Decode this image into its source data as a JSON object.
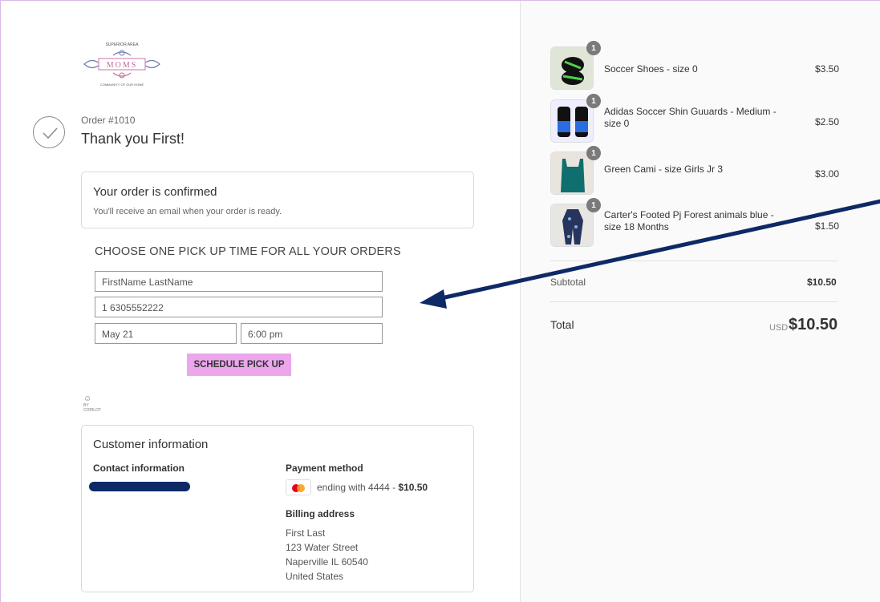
{
  "logo": {
    "text": "MOMS",
    "arc_top": "SUPERIOR AREA",
    "arc_bottom": "COMMUNITY OF OUR HOME"
  },
  "order": {
    "number": "Order #1010",
    "thanks": "Thank you First!"
  },
  "confirmation": {
    "title": "Your order is confirmed",
    "subtitle": "You'll receive an email when your order is ready."
  },
  "pickup": {
    "title": "CHOOSE ONE PICK UP TIME FOR ALL YOUR ORDERS",
    "name_value": "FirstName LastName",
    "phone_value": "1 6305552222",
    "date_value": "May 21",
    "time_value": "6:00 pm",
    "button_label": "SCHEDULE PICK UP"
  },
  "copilot": {
    "by": "BY",
    "name": "COPILOT"
  },
  "customer": {
    "title": "Customer information",
    "contact_label": "Contact information",
    "payment_label": "Payment method",
    "payment_ending": "ending with 4444 - ",
    "payment_amount": "$10.50",
    "card_icon": "mastercard-icon",
    "billing_label": "Billing address",
    "billing": [
      "First Last",
      "123 Water Street",
      "Naperville IL 60540",
      "United States"
    ]
  },
  "items": [
    {
      "name": "Soccer Shoes - size 0",
      "price": "$3.50",
      "qty": "1"
    },
    {
      "name": "Adidas Soccer Shin Guuards - Medium - size 0",
      "price": "$2.50",
      "qty": "1"
    },
    {
      "name": "Green Cami - size Girls Jr 3",
      "price": "$3.00",
      "qty": "1"
    },
    {
      "name": "Carter's Footed Pj Forest animals blue - size 18 Months",
      "price": "$1.50",
      "qty": "1"
    }
  ],
  "summary": {
    "subtotal_label": "Subtotal",
    "subtotal": "$10.50",
    "total_label": "Total",
    "currency": "USD",
    "total": "$10.50"
  },
  "colors": {
    "accent_button": "#eba6ec",
    "arrow": "#0d2a66",
    "redaction": "#0d2a66"
  }
}
